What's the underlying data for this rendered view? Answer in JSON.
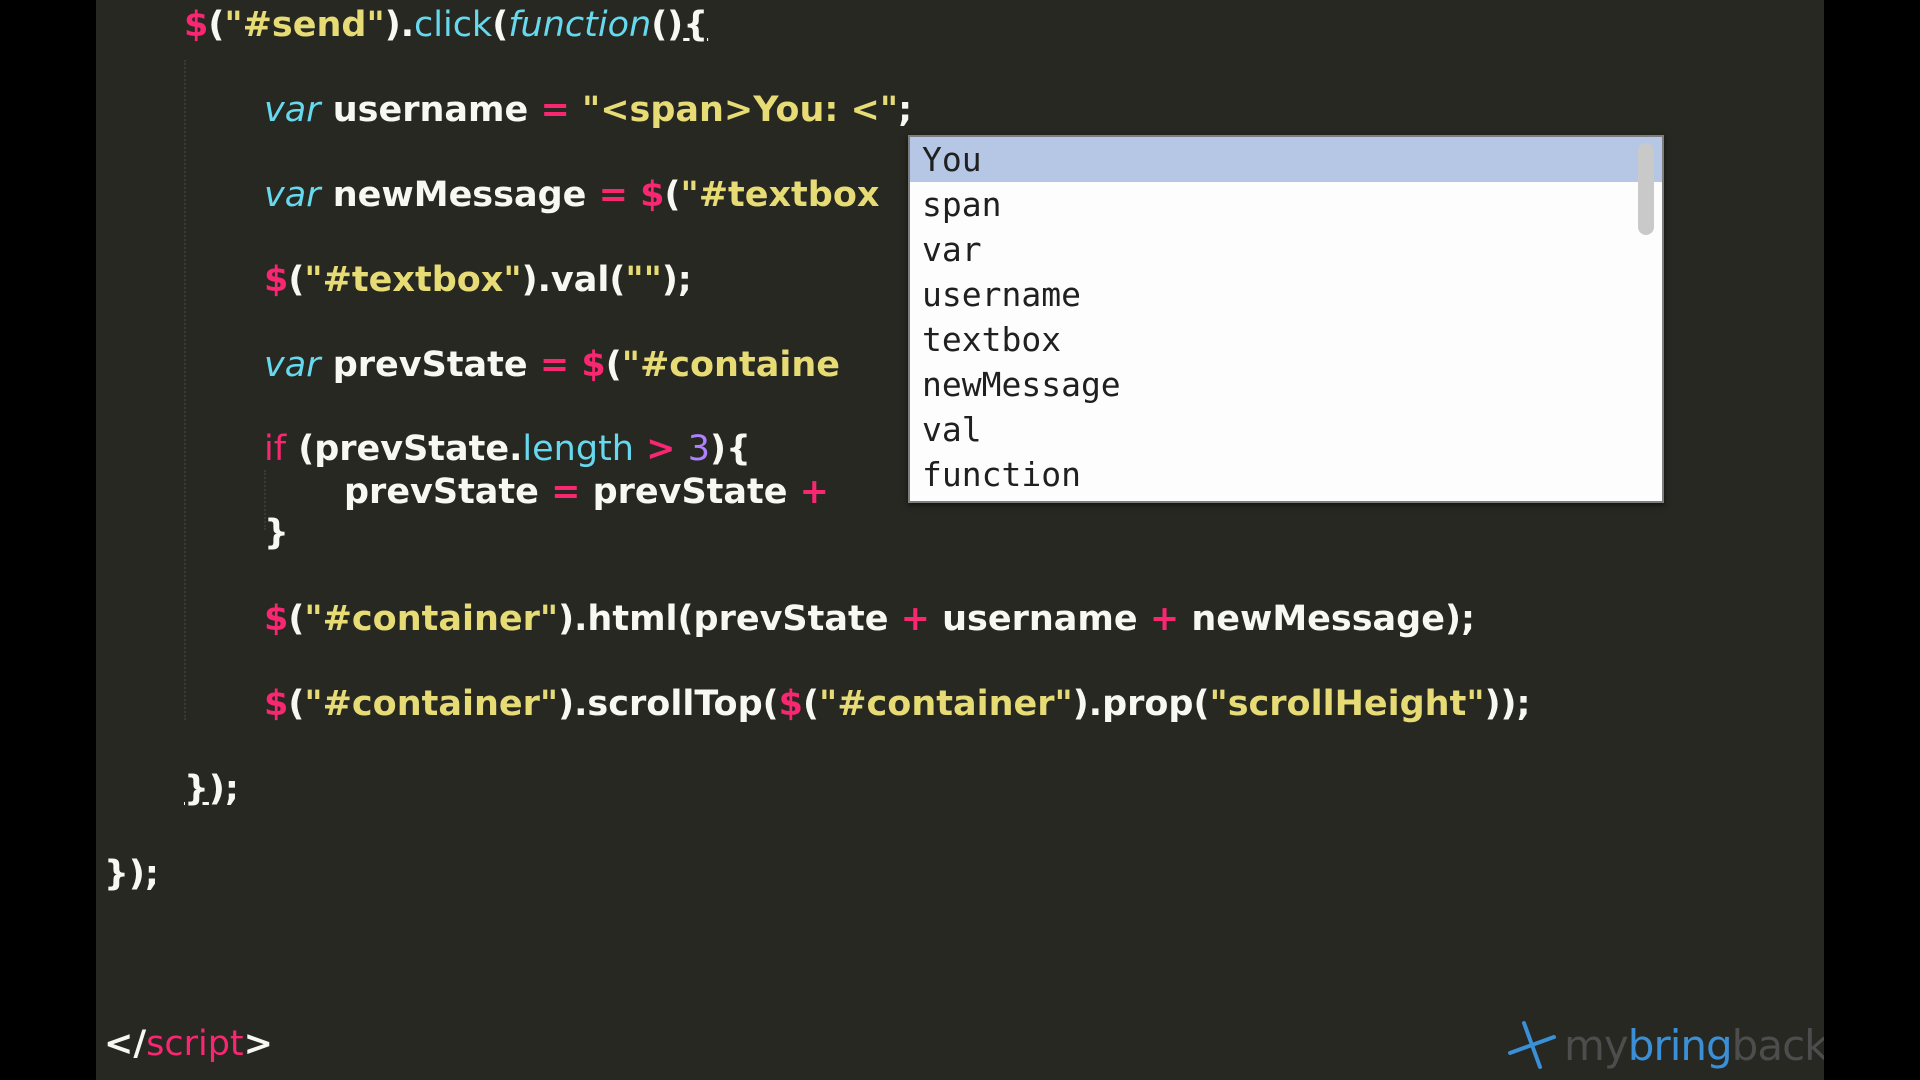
{
  "code": {
    "line1": {
      "dollar": "$",
      "a": "(",
      "str": "\"#send\"",
      "b": ").",
      "method": "click",
      "c": "(",
      "fn": "function",
      "d": "()",
      "brace": "{"
    },
    "line2": {
      "kw": "var",
      "name": " username ",
      "op": "=",
      "sp": " ",
      "str": "\"<span>You: <\"",
      "end": ";"
    },
    "line3": {
      "kw": "var",
      "name": " newMessage ",
      "op": "=",
      "sp": " ",
      "dollar": "$",
      "a": "(",
      "str": "\"#textbox"
    },
    "line4": {
      "dollar": "$",
      "a": "(",
      "str": "\"#textbox\"",
      "b": ").val(",
      "str2": "\"\"",
      "c": ");"
    },
    "line5": {
      "kw": "var",
      "name": " prevState ",
      "op": "=",
      "sp": " ",
      "dollar": "$",
      "a": "(",
      "str": "\"#containe"
    },
    "line6": {
      "kw": "if",
      "a": " (prevState.",
      "prop": "length",
      "sp": " ",
      "op": ">",
      "sp2": " ",
      "num": "3",
      "b": "){"
    },
    "line7": {
      "a": "prevState ",
      "op": "=",
      "b": " prevState ",
      "op2": "+"
    },
    "line8": {
      "a": "}"
    },
    "line9": {
      "dollar": "$",
      "a": "(",
      "str": "\"#container\"",
      "b": ").html(prevState ",
      "op": "+",
      "c": " username ",
      "op2": "+",
      "d": " newMessage);"
    },
    "line10": {
      "dollar": "$",
      "a": "(",
      "str": "\"#container\"",
      "b": ").scrollTop(",
      "dollar2": "$",
      "c": "(",
      "str2": "\"#container\"",
      "d": ").prop(",
      "str3": "\"scrollHeight\"",
      "e": "));"
    },
    "line11": {
      "brace": "}",
      "rest": ");"
    },
    "line12": {
      "a": "});"
    },
    "line13": {
      "a": "</",
      "tag": "script",
      "b": ">"
    }
  },
  "autocomplete": {
    "items": [
      "You",
      "span",
      "var",
      "username",
      "textbox",
      "newMessage",
      "val",
      "function"
    ],
    "selected_index": 0
  },
  "watermark": {
    "part1": "my",
    "part2": "bring",
    "part3": "back.com"
  },
  "colors": {
    "background": "#272822",
    "keyword": "#66d9ef",
    "operator": "#f92672",
    "string": "#e6db74",
    "number": "#ae81ff",
    "text": "#f8f8f2",
    "selection": "#b6c7e6"
  },
  "icons": {
    "watermark_logo": "windmill-logo-icon"
  }
}
